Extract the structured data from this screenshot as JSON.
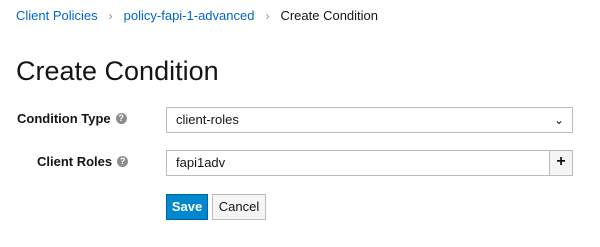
{
  "breadcrumb": {
    "items": [
      "Client Policies",
      "policy-fapi-1-advanced"
    ],
    "current": "Create Condition"
  },
  "page_title": "Create Condition",
  "form": {
    "condition_type": {
      "label": "Condition Type",
      "value": "client-roles"
    },
    "client_roles": {
      "label": "Client Roles",
      "value": "fapi1adv"
    }
  },
  "buttons": {
    "save": "Save",
    "cancel": "Cancel",
    "add": "+"
  },
  "icons": {
    "help": "help-icon",
    "chevron": "chevron-down-icon",
    "separator": "chevron-right-icon"
  },
  "colors": {
    "link": "#0066cc",
    "primary": "#0088ce"
  }
}
